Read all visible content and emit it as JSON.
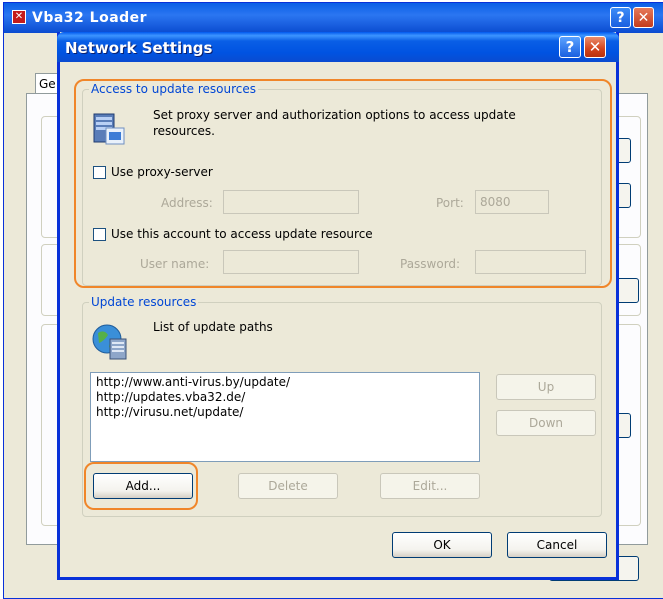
{
  "background_window": {
    "title": "Vba32 Loader",
    "tab_label": "Ge",
    "help_button_label": "?",
    "close_button_label": "✕"
  },
  "dialog": {
    "title": "Network Settings",
    "help_button_label": "?",
    "close_button_label": "✕",
    "access_group": {
      "legend": "Access to update resources",
      "description": "Set proxy server and authorization options to access update resources.",
      "icon": "server-settings-icon",
      "use_proxy_label": "Use proxy-server",
      "use_proxy_checked": false,
      "address_label": "Address:",
      "address_value": "",
      "port_label": "Port:",
      "port_value": "8080",
      "use_account_label": "Use this account to access update resource",
      "use_account_checked": false,
      "username_label": "User name:",
      "username_value": "",
      "password_label": "Password:",
      "password_value": ""
    },
    "update_group": {
      "legend": "Update resources",
      "description": "List of update paths",
      "icon": "globe-server-icon",
      "paths": [
        "http://www.anti-virus.by/update/",
        "http://updates.vba32.de/",
        "http://virusu.net/update/"
      ],
      "up_label": "Up",
      "down_label": "Down",
      "add_label": "Add...",
      "delete_label": "Delete",
      "edit_label": "Edit..."
    },
    "ok_label": "OK",
    "cancel_label": "Cancel"
  },
  "colors": {
    "highlight": "#f0862a",
    "legend_text": "#0046d5",
    "titlebar": "#0a5fe6"
  }
}
